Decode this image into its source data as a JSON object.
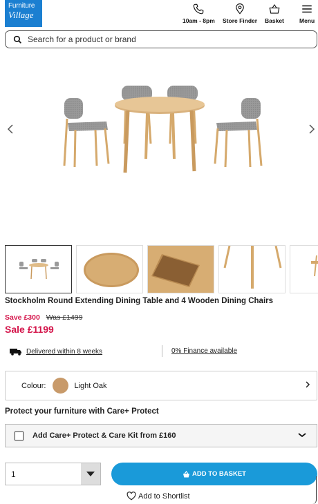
{
  "header": {
    "logo_line1": "Furniture",
    "logo_line2": "Village",
    "hours_label": "10am - 8pm",
    "store_finder_label": "Store Finder",
    "basket_label": "Basket",
    "menu_label": "Menu"
  },
  "search": {
    "placeholder": "Search for a product or brand"
  },
  "gallery": {
    "prev_icon": "chevron-left-icon",
    "next_icon": "chevron-right-icon",
    "thumbnail_count": 5,
    "active_thumbnail": 1
  },
  "product": {
    "title": "Stockholm Round Extending Dining Table and 4 Wooden Dining Chairs",
    "save_text": "Save £300",
    "was_text": "Was £1499",
    "sale_text": "Sale £1199"
  },
  "delivery": {
    "text": "Delivered within 8 weeks",
    "finance_text": "0% Finance available"
  },
  "colour": {
    "label": "Colour:",
    "value": "Light Oak",
    "swatch_color": "#c89a6a"
  },
  "care": {
    "heading": "Protect your furniture with Care+ Protect",
    "option_label": "Add Care+ Protect & Care Kit from £160"
  },
  "purchase": {
    "quantity": "1",
    "add_to_basket_label": "ADD TO BASKET",
    "shortlist_label": "Add to Shortlist"
  },
  "colors": {
    "brand_blue": "#1b7fd1",
    "button_blue": "#1a9ad9",
    "sale_red": "#d4144a"
  }
}
